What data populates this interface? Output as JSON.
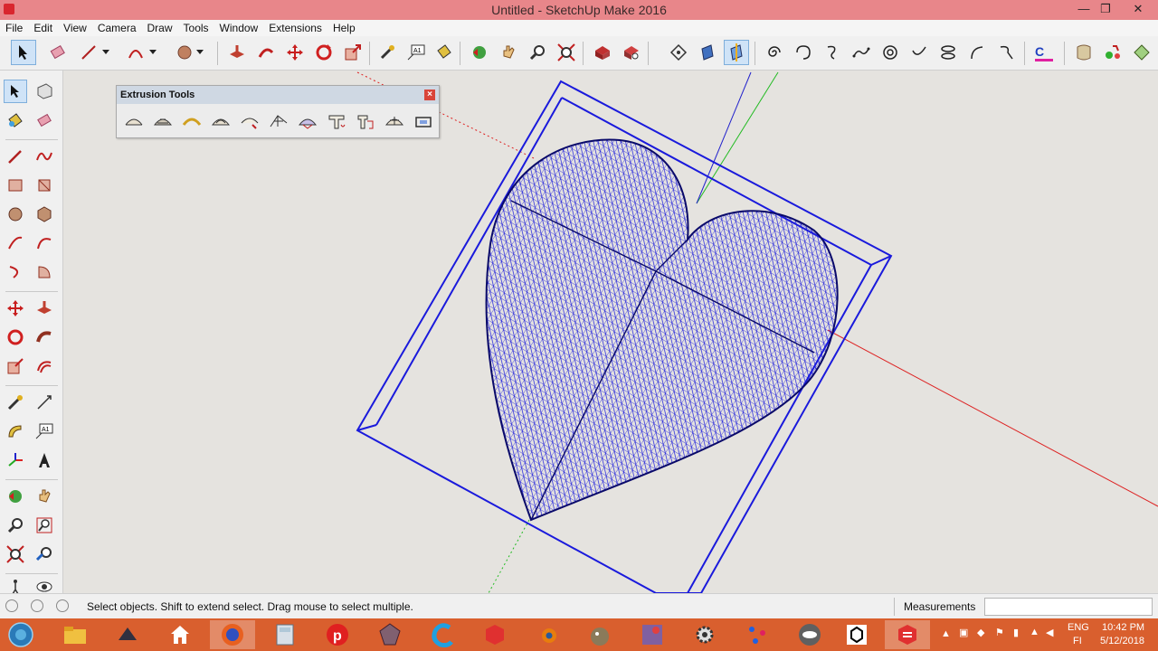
{
  "window": {
    "title": "Untitled - SketchUp Make 2016",
    "minimize": "—",
    "restore": "❐",
    "close": "✕"
  },
  "menu": [
    "File",
    "Edit",
    "View",
    "Camera",
    "Draw",
    "Tools",
    "Window",
    "Extensions",
    "Help"
  ],
  "extrusion_panel": {
    "title": "Extrusion Tools",
    "close": "×"
  },
  "status": {
    "hint": "Select objects. Shift to extend select. Drag mouse to select multiple.",
    "measurements_label": "Measurements",
    "measurements_value": ""
  },
  "tray": {
    "lang": "ENG",
    "region": "FI",
    "time": "10:42 PM",
    "date": "5/12/2018"
  },
  "colors": {
    "titlebar": "#e8868a",
    "model_lines": "#1a1adc",
    "axis_red": "#d22",
    "axis_green": "#2b2",
    "axis_blue": "#22c",
    "taskbar": "#d95f2e"
  }
}
